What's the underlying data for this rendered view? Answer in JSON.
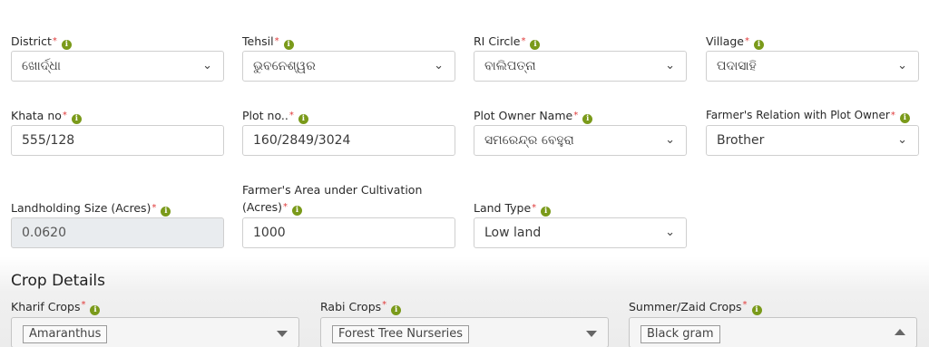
{
  "required_mark": "*",
  "info_glyph": "i",
  "colors": {
    "info": "#7a9a1a",
    "required": "#e03a3a",
    "readonly_bg": "#e9ecef"
  },
  "row1": {
    "district": {
      "label": "District",
      "value": "ଖୋର୍ଦ୍ଧା"
    },
    "tehsil": {
      "label": "Tehsil",
      "value": "ଭୁବନେଶ୍ୱର"
    },
    "ri_circle": {
      "label": "RI Circle",
      "value": "ବାଲିପତ୍ନା"
    },
    "village": {
      "label": "Village",
      "value": "ପଦାସାହି"
    }
  },
  "row2": {
    "khata_no": {
      "label": "Khata no",
      "value": "555/128"
    },
    "plot_no": {
      "label": "Plot no..",
      "value": "160/2849/3024"
    },
    "plot_owner": {
      "label": "Plot Owner Name",
      "value": "ସମରେନ୍ଦ୍ର ବେହୁରା"
    },
    "relation": {
      "label": "Farmer's Relation with Plot Owner",
      "value": "Brother"
    }
  },
  "row3": {
    "landholding": {
      "label": "Landholding Size (Acres)",
      "value": "0.0620"
    },
    "cultivation": {
      "label_line1": "Farmer's Area under Cultivation",
      "label_line2": "(Acres)",
      "value": "1000"
    },
    "land_type": {
      "label": "Land Type",
      "value": "Low land"
    }
  },
  "crop_details": {
    "title": "Crop Details",
    "kharif": {
      "label": "Kharif Crops",
      "selected": "Amaranthus"
    },
    "rabi": {
      "label": "Rabi Crops",
      "selected": "Forest Tree Nurseries"
    },
    "summer": {
      "label": "Summer/Zaid Crops",
      "selected": "Black gram"
    }
  },
  "icons": {
    "dropdown": "chevron-down-icon",
    "info": "info-icon"
  }
}
